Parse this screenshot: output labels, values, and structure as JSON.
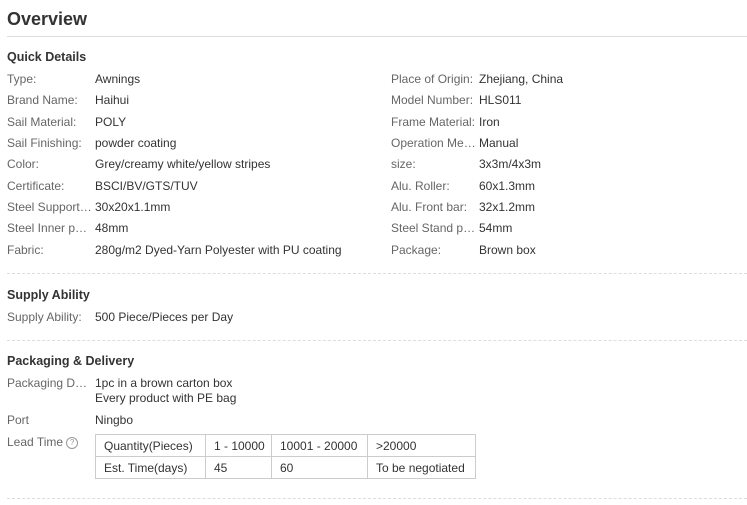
{
  "title": "Overview",
  "quick_details": {
    "heading": "Quick Details",
    "left": [
      {
        "label": "Type:",
        "value": "Awnings"
      },
      {
        "label": "Brand Name:",
        "value": "Haihui"
      },
      {
        "label": "Sail Material:",
        "value": "POLY"
      },
      {
        "label": "Sail Finishing:",
        "value": "powder coating"
      },
      {
        "label": "Color:",
        "value": "Grey/creamy white/yellow stripes"
      },
      {
        "label": "Certificate:",
        "value": "BSCI/BV/GTS/TUV"
      },
      {
        "label": "Steel Support b...",
        "value": "30x20x1.1mm"
      },
      {
        "label": "Steel Inner pole:",
        "value": "48mm"
      },
      {
        "label": "Fabric:",
        "value": "280g/m2 Dyed-Yarn Polyester with PU coating"
      }
    ],
    "right": [
      {
        "label": "Place of Origin:",
        "value": "Zhejiang, China"
      },
      {
        "label": "Model Number:",
        "value": "HLS011"
      },
      {
        "label": "Frame Material:",
        "value": "Iron"
      },
      {
        "label": "Operation Met...",
        "value": "Manual"
      },
      {
        "label": "size:",
        "value": "3x3m/4x3m"
      },
      {
        "label": "Alu. Roller:",
        "value": "60x1.3mm"
      },
      {
        "label": "Alu. Front bar:",
        "value": "32x1.2mm"
      },
      {
        "label": "Steel Stand pole:",
        "value": "54mm"
      },
      {
        "label": "Package:",
        "value": "Brown box"
      }
    ]
  },
  "supply_ability": {
    "heading": "Supply Ability",
    "label": "Supply Ability:",
    "value": "500 Piece/Pieces per Day"
  },
  "packaging": {
    "heading": "Packaging & Delivery",
    "details_label": "Packaging Det...",
    "details_line1": "1pc in a brown carton box",
    "details_line2": "Every product with PE bag",
    "port_label": "Port",
    "port_value": "Ningbo",
    "lead_label": "Lead Time",
    "help_icon_glyph": "?",
    "lead_table": {
      "row1": [
        "Quantity(Pieces)",
        "1 - 10000",
        "10001 - 20000",
        ">20000"
      ],
      "row2": [
        "Est. Time(days)",
        "45",
        "60",
        "To be negotiated"
      ]
    }
  }
}
